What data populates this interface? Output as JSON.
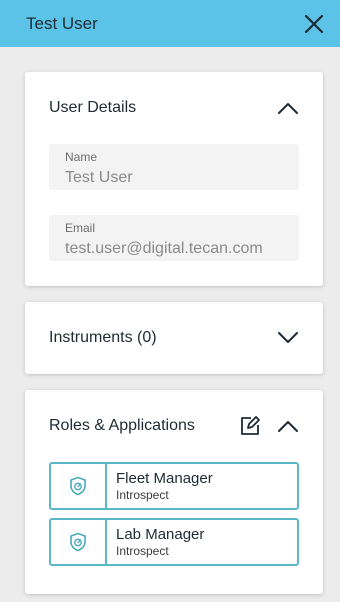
{
  "header": {
    "title": "Test User"
  },
  "user_details": {
    "title": "User Details",
    "fields": [
      {
        "label": "Name",
        "value": "Test User"
      },
      {
        "label": "Email",
        "value": "test.user@digital.tecan.com"
      }
    ]
  },
  "instruments": {
    "title": "Instruments (0)"
  },
  "roles": {
    "title": "Roles & Applications",
    "items": [
      {
        "name": "Fleet Manager",
        "app": "Introspect"
      },
      {
        "name": "Lab Manager",
        "app": "Introspect"
      }
    ]
  },
  "colors": {
    "header_bg": "#5cc3e8",
    "role_border": "#5cb8c9",
    "page_bg": "#ececec"
  },
  "icons": {
    "close": "close-icon",
    "collapse": "chevron-up-icon",
    "expand": "chevron-down-icon",
    "edit": "edit-icon",
    "role": "shield-gauge-icon"
  }
}
